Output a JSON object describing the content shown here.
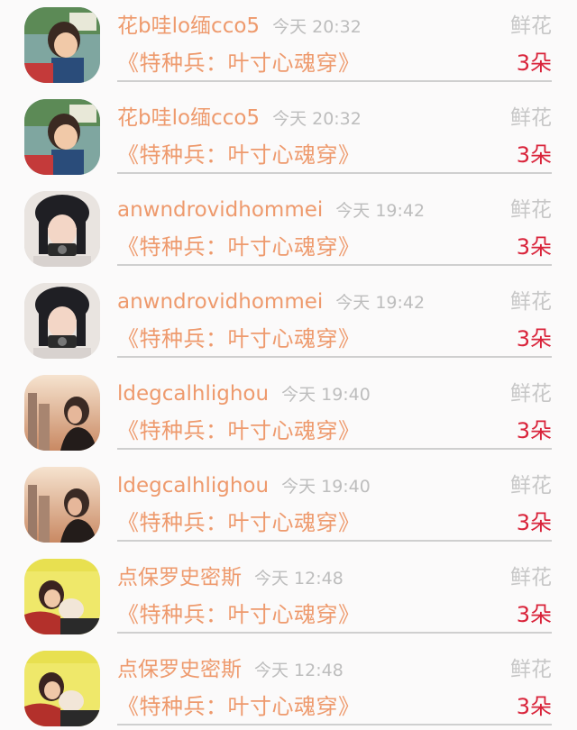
{
  "list": {
    "items": [
      {
        "name": "花b哇lo缅cco5",
        "time": "今天 20:32",
        "gift_type": "鲜花",
        "book": "《特种兵：叶寸心魂穿》",
        "count": "3朵",
        "avatar": "boy-photo"
      },
      {
        "name": "花b哇lo缅cco5",
        "time": "今天 20:32",
        "gift_type": "鲜花",
        "book": "《特种兵：叶寸心魂穿》",
        "count": "3朵",
        "avatar": "boy-photo"
      },
      {
        "name": "anwndrovidhommei",
        "time": "今天 19:42",
        "gift_type": "鲜花",
        "book": "《特种兵：叶寸心魂穿》",
        "count": "3朵",
        "avatar": "girl-camera-photo"
      },
      {
        "name": "anwndrovidhommei",
        "time": "今天 19:42",
        "gift_type": "鲜花",
        "book": "《特种兵：叶寸心魂穿》",
        "count": "3朵",
        "avatar": "girl-camera-photo"
      },
      {
        "name": "ldegcalhlighou",
        "time": "今天 19:40",
        "gift_type": "鲜花",
        "book": "《特种兵：叶寸心魂穿》",
        "count": "3朵",
        "avatar": "sunset-woman-photo"
      },
      {
        "name": "ldegcalhlighou",
        "time": "今天 19:40",
        "gift_type": "鲜花",
        "book": "《特种兵：叶寸心魂穿》",
        "count": "3朵",
        "avatar": "sunset-woman-photo"
      },
      {
        "name": "点保罗史密斯",
        "time": "今天 12:48",
        "gift_type": "鲜花",
        "book": "《特种兵：叶寸心魂穿》",
        "count": "3朵",
        "avatar": "cat-hug-photo"
      },
      {
        "name": "点保罗史密斯",
        "time": "今天 12:48",
        "gift_type": "鲜花",
        "book": "《特种兵：叶寸心魂穿》",
        "count": "3朵",
        "avatar": "cat-hug-photo"
      }
    ]
  },
  "colors": {
    "name": "#ee9a6d",
    "time": "#bdbdbd",
    "gift_type": "#c7c7c7",
    "count": "#d9233a",
    "divider": "#cfcfcf"
  }
}
